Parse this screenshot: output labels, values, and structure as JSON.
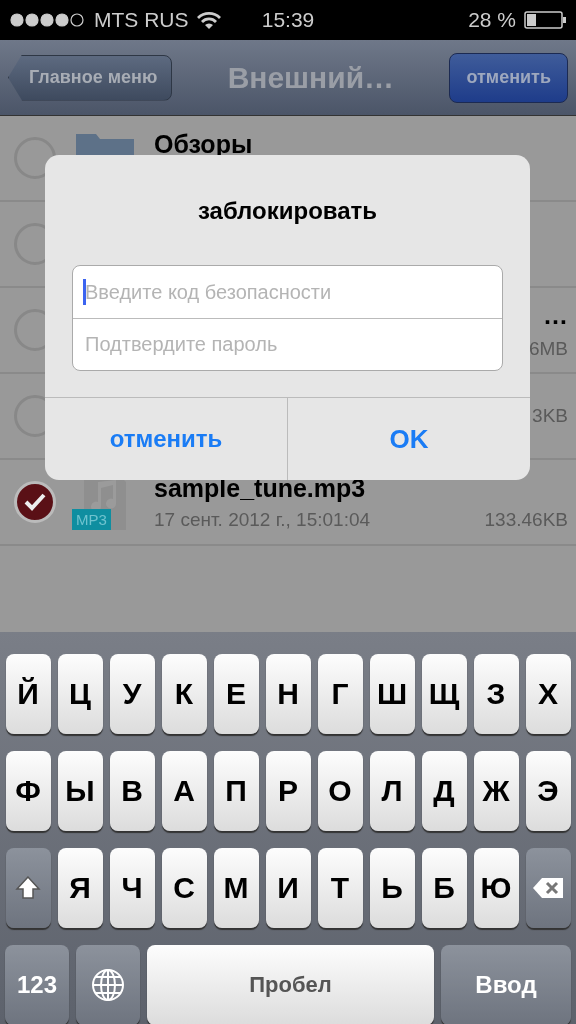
{
  "status_bar": {
    "carrier": "MTS RUS",
    "time": "15:39",
    "battery": "28 %"
  },
  "nav_bar": {
    "back": "Главное меню",
    "title": "Внешний…",
    "action": "отменить"
  },
  "rows": [
    {
      "kind": "folder",
      "selected": false,
      "name": "Обзоры"
    },
    {
      "kind": "blank",
      "selected": false
    },
    {
      "kind": "covered",
      "selected": false,
      "name": "…",
      "size": "6MB"
    },
    {
      "kind": "covered",
      "selected": false,
      "size": "3KB"
    },
    {
      "kind": "file",
      "selected": true,
      "name": "sample_tune.mp3",
      "date": "17 сент. 2012 г., 15:01:04",
      "size": "133.46KB",
      "badge": "MP3"
    }
  ],
  "dialog": {
    "title": "заблокировать",
    "fields": [
      {
        "placeholder": "Введите код безопасности",
        "focused": true
      },
      {
        "placeholder": "Подтвердите пароль",
        "focused": false
      }
    ],
    "buttons": [
      {
        "label": "отменить",
        "bold": false
      },
      {
        "label": "OK",
        "bold": true
      }
    ]
  },
  "keyboard": [
    [
      {
        "kind": "letter",
        "label": "Й"
      },
      {
        "kind": "letter",
        "label": "Ц"
      },
      {
        "kind": "letter",
        "label": "У"
      },
      {
        "kind": "letter",
        "label": "К"
      },
      {
        "kind": "letter",
        "label": "Е"
      },
      {
        "kind": "letter",
        "label": "Н"
      },
      {
        "kind": "letter",
        "label": "Г"
      },
      {
        "kind": "letter",
        "label": "Ш"
      },
      {
        "kind": "letter",
        "label": "Щ"
      },
      {
        "kind": "letter",
        "label": "З"
      },
      {
        "kind": "letter",
        "label": "Х"
      }
    ],
    [
      {
        "kind": "letter",
        "label": "Ф"
      },
      {
        "kind": "letter",
        "label": "Ы"
      },
      {
        "kind": "letter",
        "label": "В"
      },
      {
        "kind": "letter",
        "label": "А"
      },
      {
        "kind": "letter",
        "label": "П"
      },
      {
        "kind": "letter",
        "label": "Р"
      },
      {
        "kind": "letter",
        "label": "О"
      },
      {
        "kind": "letter",
        "label": "Л"
      },
      {
        "kind": "letter",
        "label": "Д"
      },
      {
        "kind": "letter",
        "label": "Ж"
      },
      {
        "kind": "letter",
        "label": "Э"
      }
    ],
    [
      {
        "kind": "shift"
      },
      {
        "kind": "letter",
        "label": "Я"
      },
      {
        "kind": "letter",
        "label": "Ч"
      },
      {
        "kind": "letter",
        "label": "С"
      },
      {
        "kind": "letter",
        "label": "М"
      },
      {
        "kind": "letter",
        "label": "И"
      },
      {
        "kind": "letter",
        "label": "Т"
      },
      {
        "kind": "letter",
        "label": "Ь"
      },
      {
        "kind": "letter",
        "label": "Б"
      },
      {
        "kind": "letter",
        "label": "Ю"
      },
      {
        "kind": "backspace"
      }
    ],
    [
      {
        "kind": "numbers",
        "label": "123"
      },
      {
        "kind": "globe"
      },
      {
        "kind": "space",
        "label": "Пробел"
      },
      {
        "kind": "return",
        "label": "Ввод"
      }
    ]
  ]
}
